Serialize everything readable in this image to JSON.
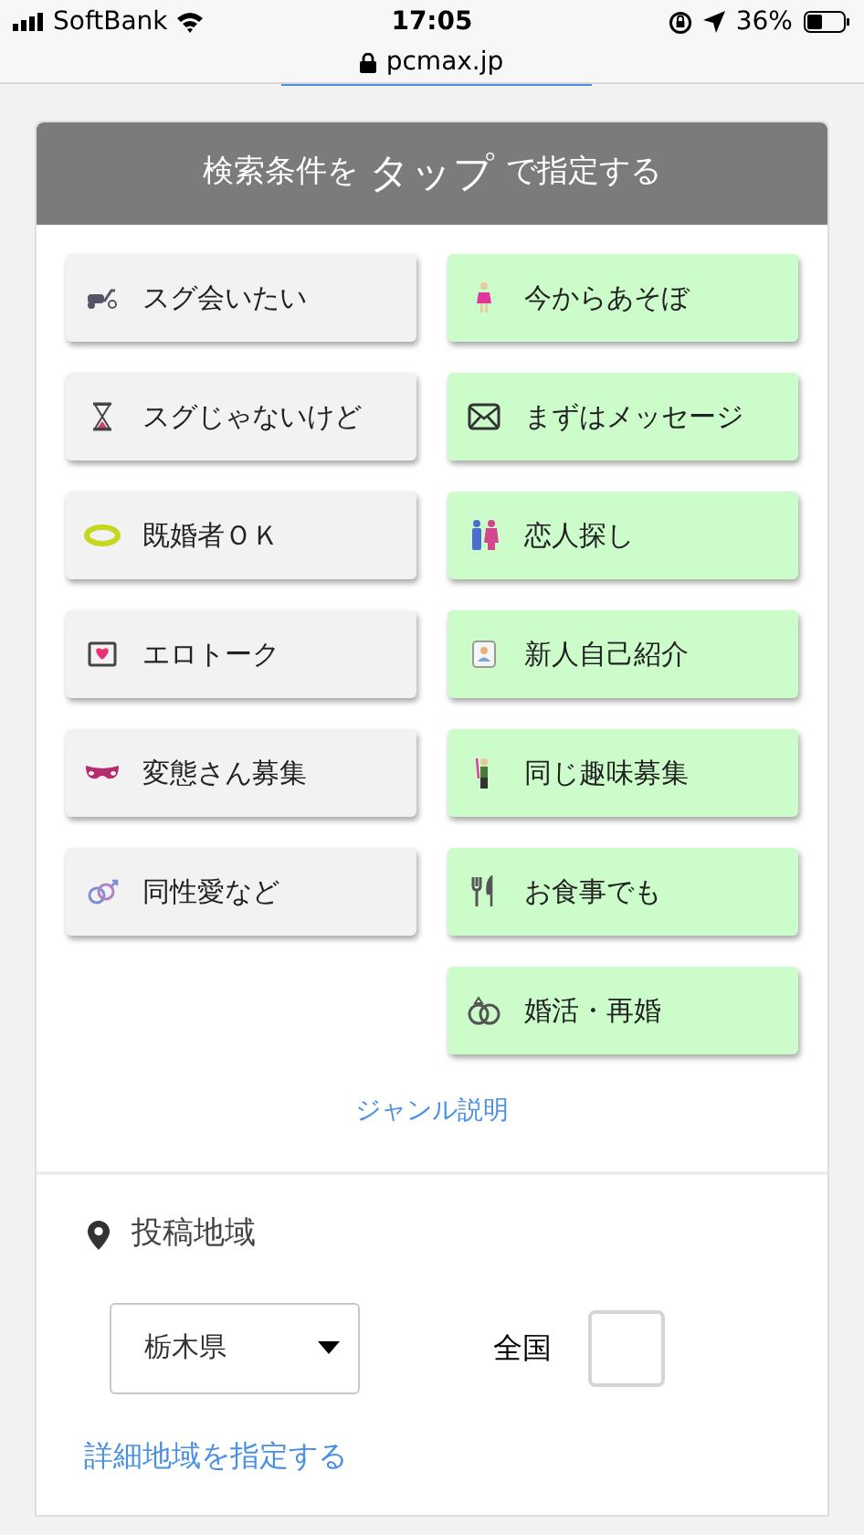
{
  "status_bar": {
    "carrier": "SoftBank",
    "time": "17:05",
    "battery": "36%"
  },
  "address_bar": {
    "url": "pcmax.jp"
  },
  "search_card": {
    "title_before": "検索条件を",
    "title_emphasis": "タップ",
    "title_after": "で指定する",
    "columns": [
      [
        {
          "label": "スグ会いたい",
          "selected": false
        },
        {
          "label": "スグじゃないけど",
          "selected": false
        },
        {
          "label": "既婚者ＯＫ",
          "selected": false
        },
        {
          "label": "エロトーク",
          "selected": false
        },
        {
          "label": "変態さん募集",
          "selected": false
        },
        {
          "label": "同性愛など",
          "selected": false
        }
      ],
      [
        {
          "label": "今からあそぼ",
          "selected": true
        },
        {
          "label": "まずはメッセージ",
          "selected": true
        },
        {
          "label": "恋人探し",
          "selected": true
        },
        {
          "label": "新人自己紹介",
          "selected": true
        },
        {
          "label": "同じ趣味募集",
          "selected": true
        },
        {
          "label": "お食事でも",
          "selected": true
        },
        {
          "label": "婚活・再婚",
          "selected": true
        }
      ]
    ],
    "genre_link": "ジャンル説明"
  },
  "region": {
    "heading": "投稿地域",
    "prefecture": "栃木県",
    "nationwide_label": "全国",
    "nationwide_checked": false,
    "detail_link": "詳細地域を指定する"
  }
}
